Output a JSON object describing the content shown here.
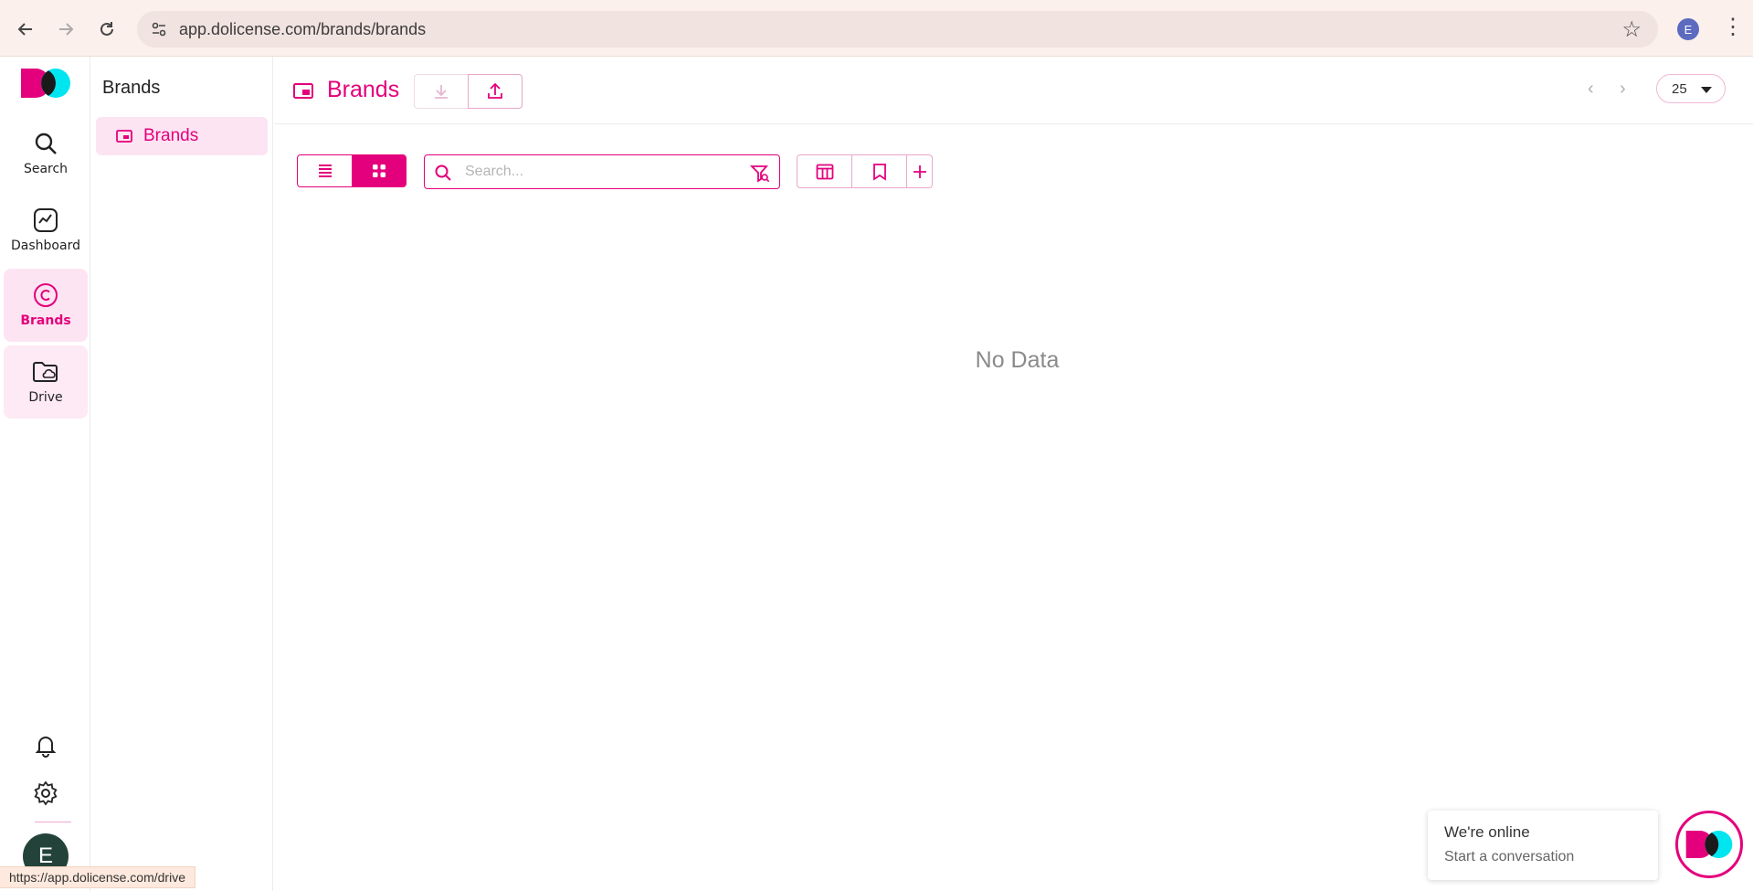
{
  "browser": {
    "url": "app.dolicense.com/brands/brands",
    "profile_initial": "E"
  },
  "rail": {
    "items": [
      {
        "label": "Search",
        "icon": "search-icon"
      },
      {
        "label": "Dashboard",
        "icon": "chart-icon"
      },
      {
        "label": "Brands",
        "icon": "copyright-icon"
      },
      {
        "label": "Drive",
        "icon": "folder-cloud-icon"
      }
    ],
    "avatar_initial": "E"
  },
  "sidebar": {
    "title": "Brands",
    "items": [
      {
        "label": "Brands"
      }
    ]
  },
  "header": {
    "title": "Brands",
    "page_size": "25"
  },
  "toolbar": {
    "search_placeholder": "Search..."
  },
  "content": {
    "empty_text": "No Data"
  },
  "chat": {
    "title": "We're online",
    "subtitle": "Start a conversation"
  },
  "status_bar": {
    "url": "https://app.dolicense.com/drive"
  },
  "colors": {
    "accent": "#e4007c",
    "accent_soft": "#fde4f2",
    "logo_cyan": "#00e5f0"
  }
}
